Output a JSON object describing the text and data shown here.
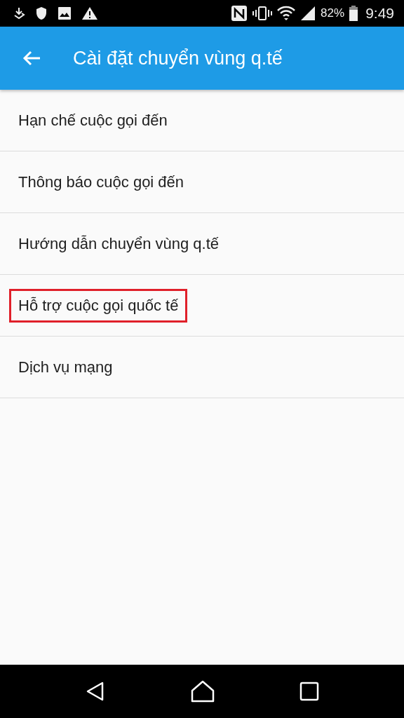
{
  "status_bar": {
    "battery": "82%",
    "time": "9:49"
  },
  "app_bar": {
    "title": "Cài đặt chuyển vùng q.tế"
  },
  "items": [
    {
      "label": "Hạn chế cuộc gọi đến",
      "highlighted": false
    },
    {
      "label": "Thông báo cuộc gọi đến",
      "highlighted": false
    },
    {
      "label": "Hướng dẫn chuyển vùng q.tế",
      "highlighted": false
    },
    {
      "label": "Hỗ trợ cuộc gọi quốc tế",
      "highlighted": true
    },
    {
      "label": "Dịch vụ mạng",
      "highlighted": false
    }
  ]
}
